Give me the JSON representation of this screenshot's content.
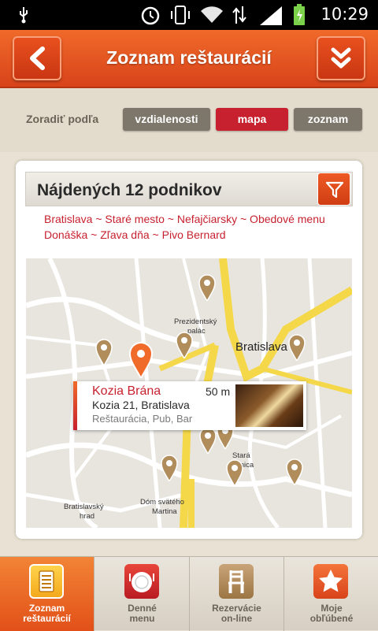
{
  "status_bar": {
    "time": "10:29"
  },
  "header": {
    "title": "Zoznam reštaurácií",
    "back_icon": "back-arrow-icon",
    "menu_icon": "double-chevron-down-icon"
  },
  "sort": {
    "label": "Zoradiť podľa",
    "options": [
      "vzdialenosti",
      "mapa",
      "zoznam"
    ],
    "selected": "mapa"
  },
  "results": {
    "title": "Nájdených 12 podnikov",
    "tags_line1": "Bratislava ~ Staré mesto ~ Nefajčiarsky ~ Obedové menu",
    "tags_line2": "Donáška ~ Zľava dňa ~ Pivo Bernard"
  },
  "map": {
    "labels": [
      "Bratislava",
      "Dóm svätého Martina",
      "Bratislavský hrad",
      "Stará radnica",
      "Prezidentský palác"
    ],
    "popup": {
      "name": "Kozia Brána",
      "distance": "50 m",
      "address": "Kozia 21, Bratislava",
      "types": "Reštaurácia, Pub, Bar"
    }
  },
  "nav": {
    "items": [
      {
        "label1": "Zoznam",
        "label2": "reštaurácií",
        "icon": "list-icon"
      },
      {
        "label1": "Denné",
        "label2": "menu",
        "icon": "plate-icon"
      },
      {
        "label1": "Rezervácie",
        "label2": "on-line",
        "icon": "chair-icon"
      },
      {
        "label1": "Moje",
        "label2": "obľúbené",
        "icon": "star-icon"
      }
    ]
  },
  "colors": {
    "accent": "#e25018",
    "selected": "#c7212f",
    "neutral_button": "#7d766a"
  }
}
